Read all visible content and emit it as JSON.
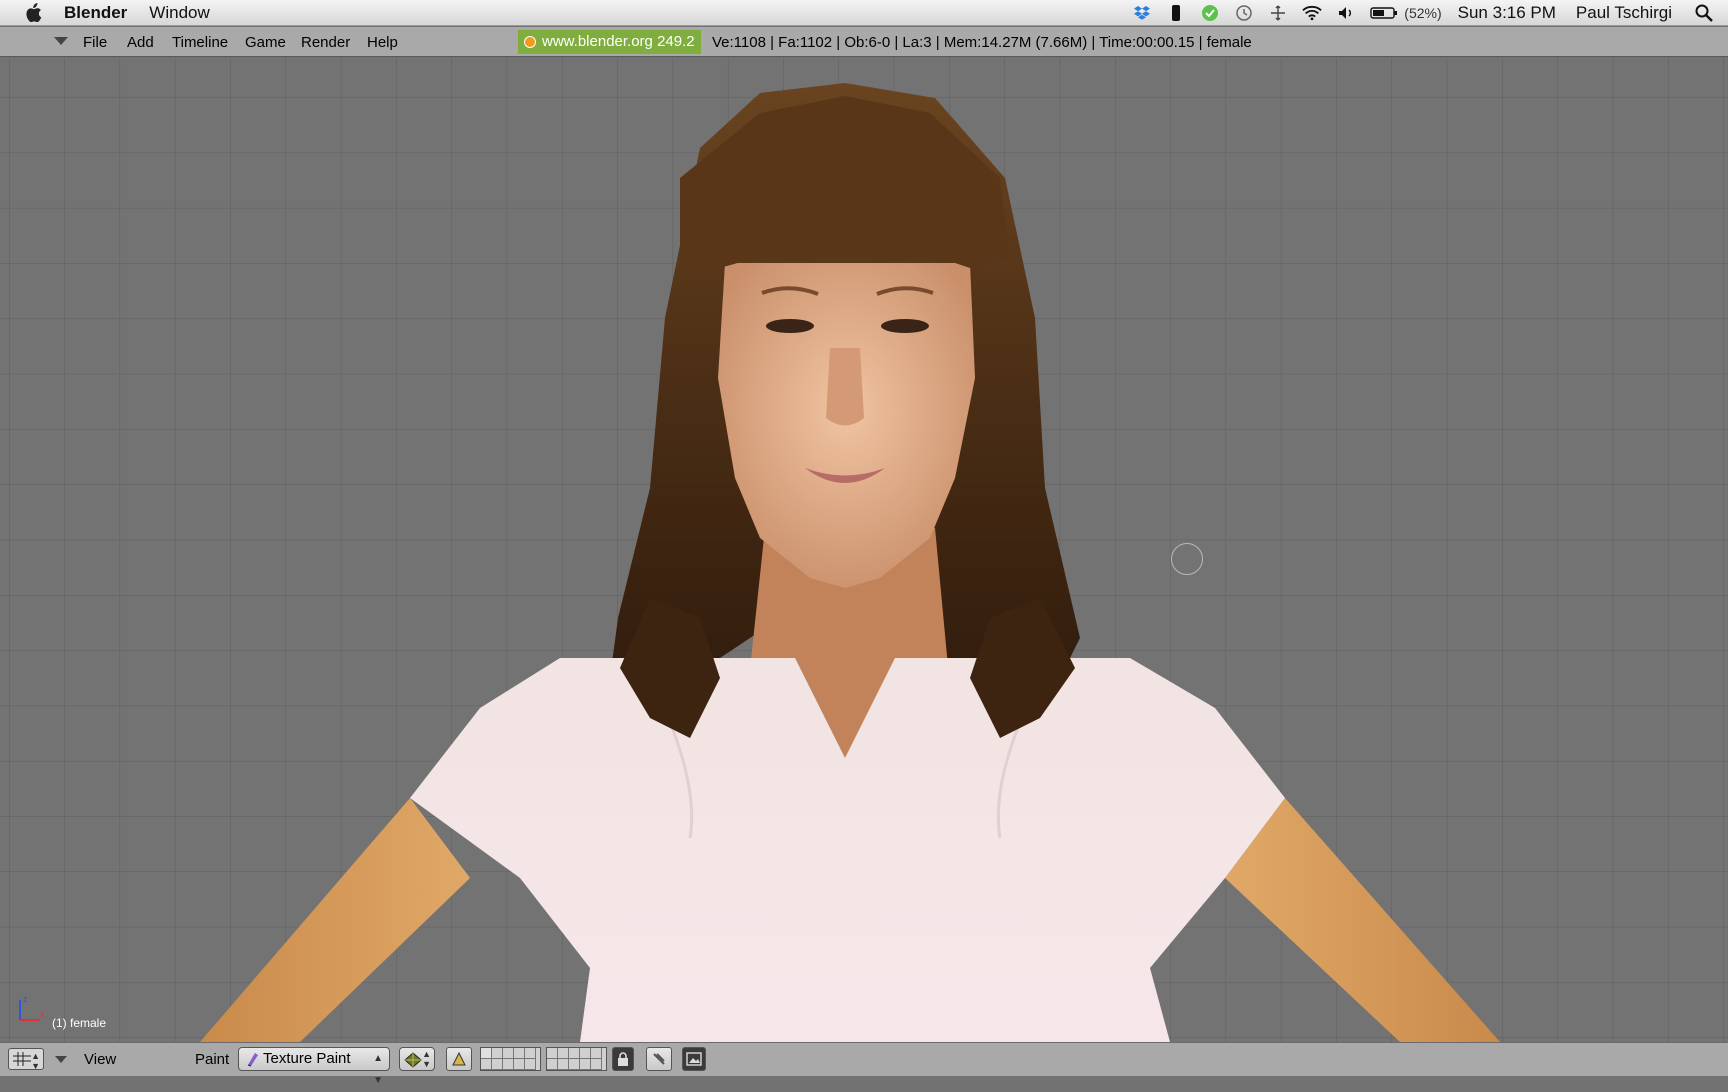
{
  "mac_menubar": {
    "app_name": "Blender",
    "menus": [
      "Window"
    ],
    "battery_percent": "(52%)",
    "clock": "Sun 3:16 PM",
    "user": "Paul Tschirgi"
  },
  "blender_header": {
    "menus": [
      "File",
      "Add",
      "Timeline",
      "Game",
      "Render",
      "Help"
    ],
    "version_label": "www.blender.org 249.2",
    "stats": "Ve:1108 | Fa:1102 | Ob:6-0 | La:3  | Mem:14.27M (7.66M)  | Time:00:00.15 | female"
  },
  "viewport": {
    "object_label": "(1) female",
    "axis_labels": {
      "z": "z",
      "x": "x"
    }
  },
  "bottom_bar": {
    "view_menu": "View",
    "paint_menu": "Paint",
    "mode_select": "Texture Paint"
  },
  "colors": {
    "viewport_bg": "#737373",
    "grid_line": "#5f5f5f",
    "header_bg": "#a9a9a9",
    "logo_green": "#7fae3f"
  }
}
